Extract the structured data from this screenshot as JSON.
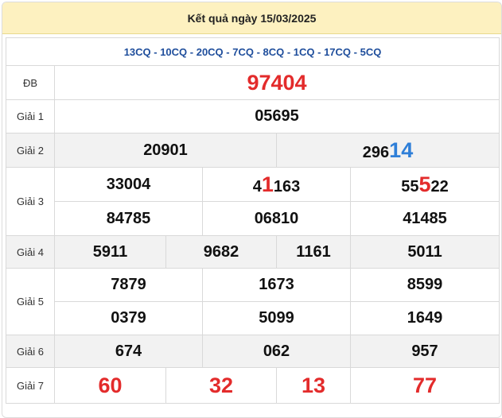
{
  "header": {
    "title": "Kết quả ngày 15/03/2025"
  },
  "codes": "13CQ - 10CQ - 20CQ - 7CQ - 8CQ - 1CQ - 17CQ - 5CQ",
  "prizes": {
    "db": {
      "label": "ĐB",
      "value": "97404"
    },
    "g1": {
      "label": "Giải 1",
      "value": "05695"
    },
    "g2": {
      "label": "Giải 2",
      "values": [
        {
          "plain": "20901",
          "highlight": ""
        },
        {
          "plain": "296",
          "highlight": "14"
        }
      ]
    },
    "g3": {
      "label": "Giải 3",
      "row1": [
        {
          "pre": "33004",
          "hl": "",
          "post": ""
        },
        {
          "pre": "4",
          "hl": "1",
          "post": "163"
        },
        {
          "pre": "55",
          "hl": "5",
          "post": "22"
        }
      ],
      "row2": [
        "84785",
        "06810",
        "41485"
      ]
    },
    "g4": {
      "label": "Giải 4",
      "values": [
        "5911",
        "9682",
        "1161",
        "5011"
      ]
    },
    "g5": {
      "label": "Giải 5",
      "row1": [
        "7879",
        "1673",
        "8599"
      ],
      "row2": [
        "0379",
        "5099",
        "1649"
      ]
    },
    "g6": {
      "label": "Giải 6",
      "values": [
        "674",
        "062",
        "957"
      ]
    },
    "g7": {
      "label": "Giải 7",
      "values": [
        "60",
        "32",
        "13",
        "77"
      ]
    }
  },
  "colors": {
    "highlight_red": "#e32b2b",
    "highlight_blue": "#2f7fd8",
    "header_bg": "#fdf1c0",
    "codes_text": "#1f4e9c"
  }
}
